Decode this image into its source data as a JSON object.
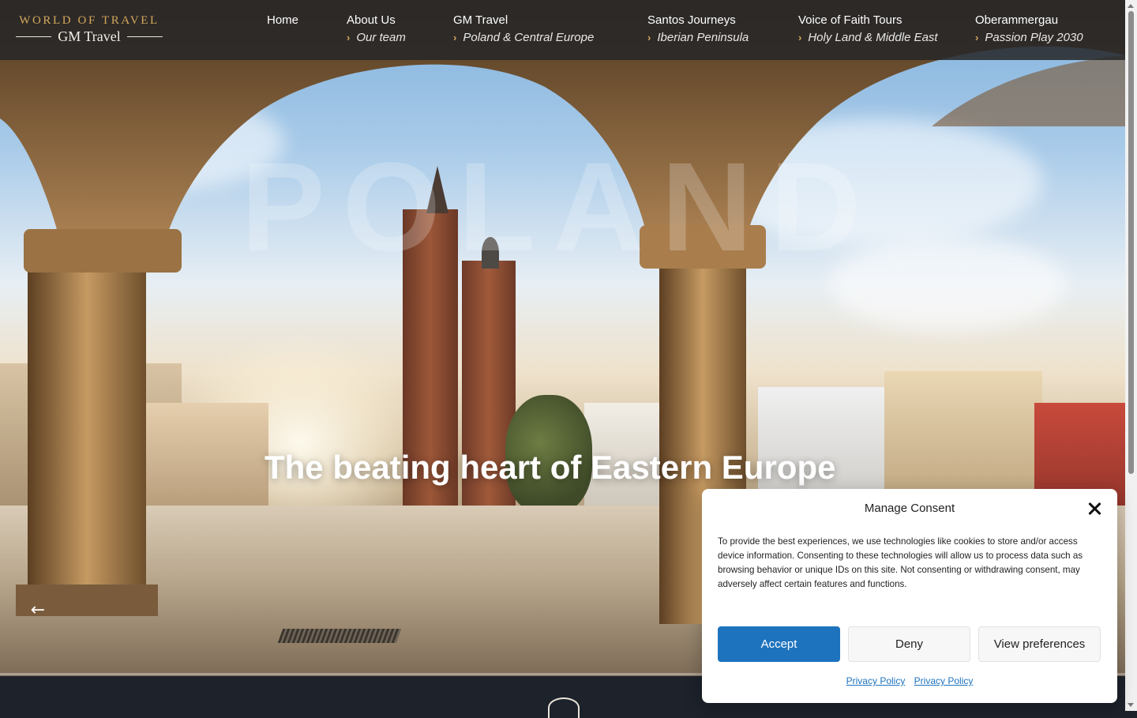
{
  "brand": {
    "logo_top": "WORLD OF TRAVEL",
    "logo_bottom": "GM Travel",
    "accent_color": "#d4a85c"
  },
  "nav": {
    "items": [
      {
        "label": "Home",
        "sub": ""
      },
      {
        "label": "About Us",
        "sub": "Our team"
      },
      {
        "label": "GM Travel",
        "sub": "Poland & Central Europe"
      },
      {
        "label": "Santos Journeys",
        "sub": "Iberian Peninsula"
      },
      {
        "label": "Voice of Faith Tours",
        "sub": "Holy Land & Middle East"
      },
      {
        "label": "Oberammergau",
        "sub": "Passion Play 2030"
      }
    ],
    "sub_icon": "chevron-right-icon"
  },
  "hero": {
    "ghost_word": "POLAND",
    "title": "The beating heart of Eastern Europe",
    "prev_icon": "arrow-left-icon"
  },
  "consent": {
    "title": "Manage Consent",
    "body": "To provide the best experiences, we use technologies like cookies to store and/or access device information. Consenting to these technologies will allow us to process data such as browsing behavior or unique IDs on this site. Not consenting or withdrawing consent, may adversely affect certain features and functions.",
    "accept": "Accept",
    "deny": "Deny",
    "preferences": "View preferences",
    "link_1": "Privacy Policy",
    "link_2": "Privacy Policy",
    "accept_color": "#1e73be"
  }
}
